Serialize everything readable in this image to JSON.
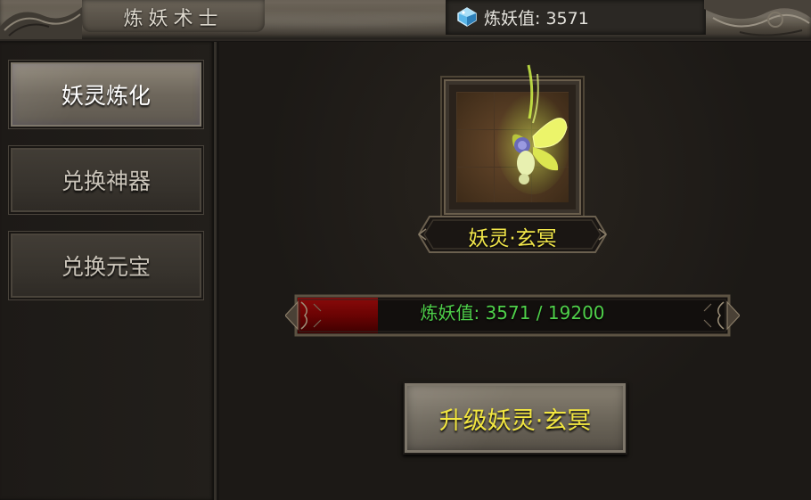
{
  "header": {
    "title": "炼妖术士",
    "currency_icon": "gem-icon",
    "currency_text": "炼妖值: 3571"
  },
  "sidebar": {
    "items": [
      {
        "label": "妖灵炼化",
        "active": true
      },
      {
        "label": "兑换神器",
        "active": false
      },
      {
        "label": "兑换元宝",
        "active": false
      }
    ]
  },
  "main": {
    "item_name": "妖灵·玄冥",
    "item_icon": "fairy-spirit-icon",
    "progress": {
      "current": 3571,
      "max": 19200,
      "text": "炼妖值: 3571 / 19200"
    },
    "upgrade_button_label": "升级妖灵·玄冥"
  },
  "colors": {
    "accent_yellow": "#f1e64a",
    "progress_text_green": "#4fd04a",
    "progress_fill_red": "#6a0303"
  }
}
